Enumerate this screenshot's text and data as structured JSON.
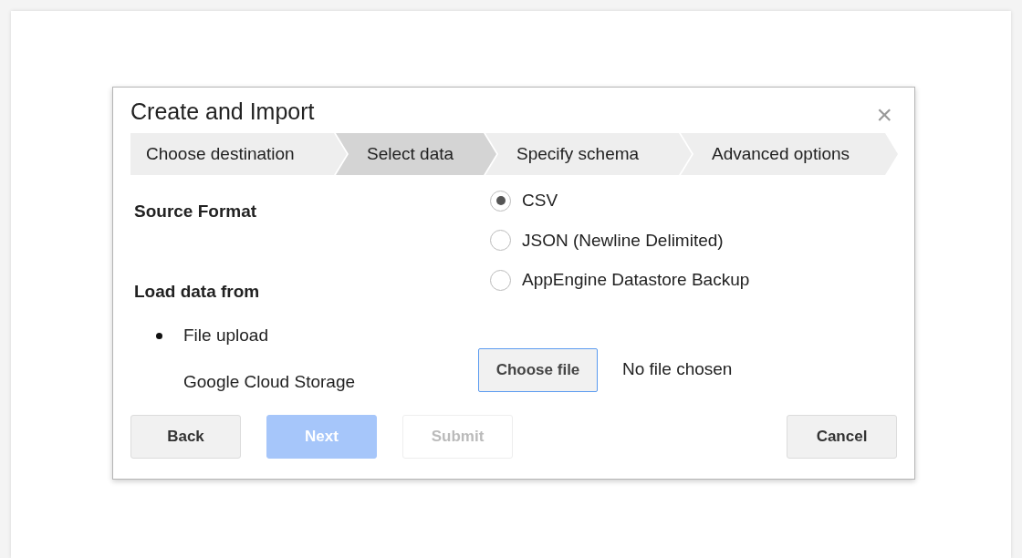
{
  "dialog": {
    "title": "Create and Import",
    "close": "×"
  },
  "steps": [
    {
      "label": "Choose destination",
      "selected": false
    },
    {
      "label": "Select data",
      "selected": true
    },
    {
      "label": "Specify schema",
      "selected": false
    },
    {
      "label": "Advanced options",
      "selected": false
    }
  ],
  "source_format": {
    "label": "Source Format",
    "options": [
      {
        "label": "CSV",
        "selected": true
      },
      {
        "label": "JSON (Newline Delimited)",
        "selected": false
      },
      {
        "label": "AppEngine Datastore Backup",
        "selected": false
      }
    ]
  },
  "load_data_from": {
    "label": "Load data from",
    "options": [
      {
        "label": "File upload",
        "selected": true
      },
      {
        "label": "Google Cloud Storage",
        "selected": false
      }
    ]
  },
  "file_input": {
    "button": "Choose file",
    "status": "No file chosen"
  },
  "buttons": [
    {
      "label": "Back",
      "kind": "default",
      "disabled": false
    },
    {
      "label": "Next",
      "kind": "primary",
      "disabled": true
    },
    {
      "label": "Submit",
      "kind": "default",
      "disabled": true
    },
    {
      "label": "Cancel",
      "kind": "default",
      "disabled": false
    }
  ]
}
